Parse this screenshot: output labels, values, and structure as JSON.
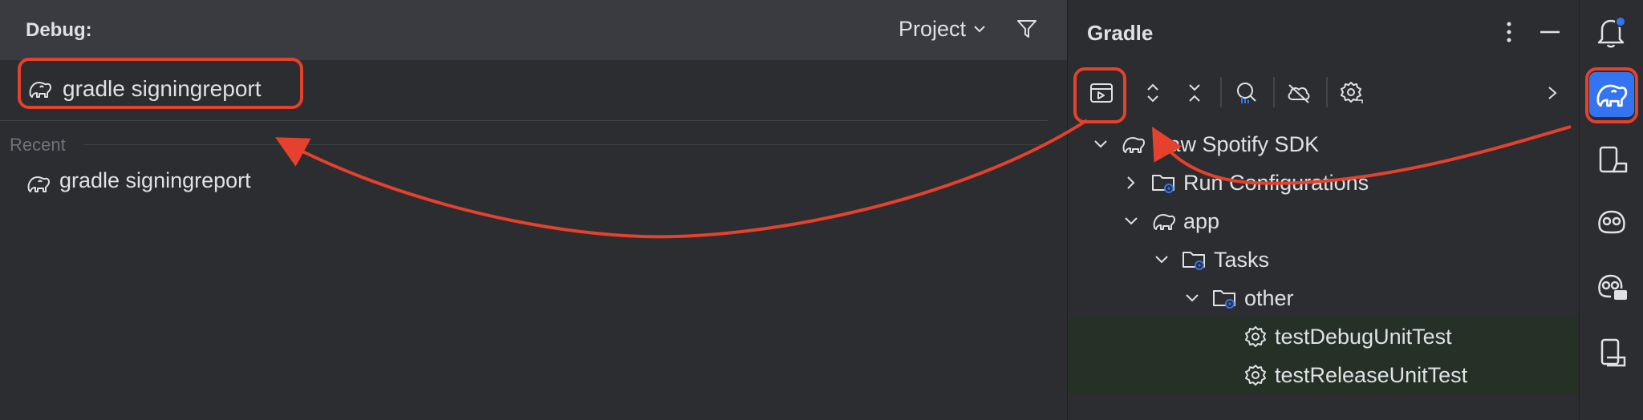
{
  "run_anything": {
    "header_label": "Debug:",
    "scope_dropdown": "Project",
    "search_value": "gradle signingreport",
    "recent_label": "Recent",
    "recent_items": [
      {
        "label": "gradle signingreport",
        "icon": "gradle-elephant-icon"
      }
    ]
  },
  "gradle": {
    "title": "Gradle",
    "toolbar": [
      "run-task-icon",
      "expand-all-icon",
      "collapse-all-icon",
      "analyze-dependencies-icon",
      "offline-mode-icon",
      "gradle-settings-icon",
      "chevron-right-icon"
    ],
    "tree": [
      {
        "label": "Raw Spotify SDK",
        "icon": "gradle-elephant-icon",
        "expanded": true
      },
      {
        "label": "Run Configurations",
        "icon": "folder-gear-icon",
        "expanded": false
      },
      {
        "label": "app",
        "icon": "gradle-elephant-icon",
        "expanded": true
      },
      {
        "label": "Tasks",
        "icon": "folder-gear-icon",
        "expanded": true
      },
      {
        "label": "other",
        "icon": "folder-gear-icon",
        "expanded": true
      },
      {
        "label": "testDebugUnitTest",
        "icon": "gear-icon"
      },
      {
        "label": "testReleaseUnitTest",
        "icon": "gear-icon"
      }
    ]
  },
  "tool_strip": [
    "notifications-icon",
    "gradle-elephant-icon",
    "device-manager-icon",
    "gemini-icon",
    "copilot-chat-icon",
    "running-devices-icon"
  ],
  "colors": {
    "accent": "#3574f0",
    "highlight": "#e5412d",
    "task_row_bg": "#253027",
    "notification_dot": "#3574f0"
  }
}
